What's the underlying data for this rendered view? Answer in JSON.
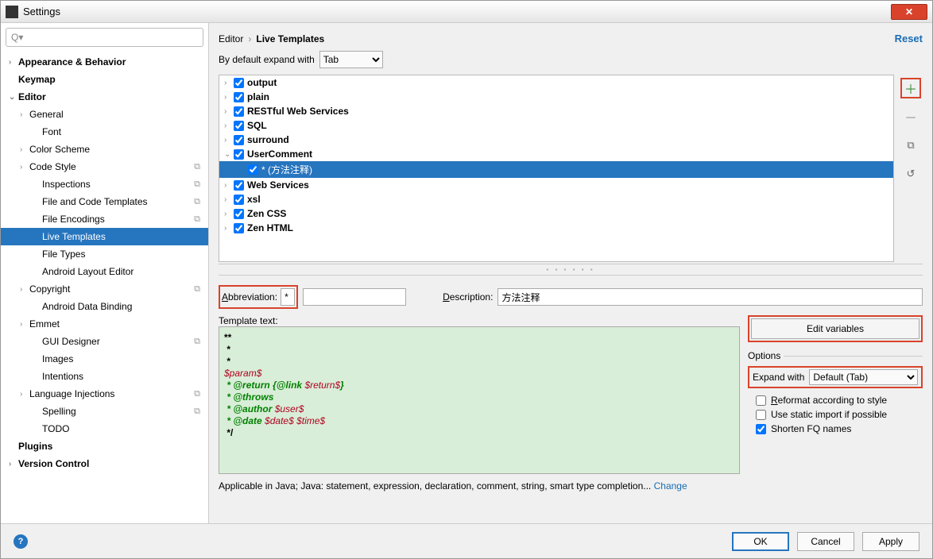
{
  "window": {
    "title": "Settings"
  },
  "breadcrumb": {
    "parent": "Editor",
    "current": "Live Templates",
    "reset": "Reset"
  },
  "search": {
    "placeholder": ""
  },
  "sidebar": {
    "items": [
      {
        "label": "Appearance & Behavior",
        "arrow": "›",
        "bold": true
      },
      {
        "label": "Keymap",
        "arrow": "",
        "bold": true
      },
      {
        "label": "Editor",
        "arrow": "⌄",
        "bold": true
      },
      {
        "label": "General",
        "arrow": "›",
        "indent": 1
      },
      {
        "label": "Font",
        "arrow": "",
        "indent": 2
      },
      {
        "label": "Color Scheme",
        "arrow": "›",
        "indent": 1
      },
      {
        "label": "Code Style",
        "arrow": "›",
        "indent": 1,
        "copyicon": true
      },
      {
        "label": "Inspections",
        "arrow": "",
        "indent": 2,
        "copyicon": true
      },
      {
        "label": "File and Code Templates",
        "arrow": "",
        "indent": 2,
        "copyicon": true
      },
      {
        "label": "File Encodings",
        "arrow": "",
        "indent": 2,
        "copyicon": true
      },
      {
        "label": "Live Templates",
        "arrow": "",
        "indent": 2,
        "selected": true
      },
      {
        "label": "File Types",
        "arrow": "",
        "indent": 2
      },
      {
        "label": "Android Layout Editor",
        "arrow": "",
        "indent": 2
      },
      {
        "label": "Copyright",
        "arrow": "›",
        "indent": 1,
        "copyicon": true
      },
      {
        "label": "Android Data Binding",
        "arrow": "",
        "indent": 2
      },
      {
        "label": "Emmet",
        "arrow": "›",
        "indent": 1
      },
      {
        "label": "GUI Designer",
        "arrow": "",
        "indent": 2,
        "copyicon": true
      },
      {
        "label": "Images",
        "arrow": "",
        "indent": 2
      },
      {
        "label": "Intentions",
        "arrow": "",
        "indent": 2
      },
      {
        "label": "Language Injections",
        "arrow": "›",
        "indent": 1,
        "copyicon": true
      },
      {
        "label": "Spelling",
        "arrow": "",
        "indent": 2,
        "copyicon": true
      },
      {
        "label": "TODO",
        "arrow": "",
        "indent": 2
      },
      {
        "label": "Plugins",
        "arrow": "",
        "bold": true
      },
      {
        "label": "Version Control",
        "arrow": "›",
        "bold": true
      }
    ]
  },
  "expandDefault": {
    "label": "By default expand with",
    "value": "Tab"
  },
  "templates": [
    {
      "label": "output",
      "arrow": "›",
      "checked": true
    },
    {
      "label": "plain",
      "arrow": "›",
      "checked": true
    },
    {
      "label": "RESTful Web Services",
      "arrow": "›",
      "checked": true
    },
    {
      "label": "SQL",
      "arrow": "›",
      "checked": true
    },
    {
      "label": "surround",
      "arrow": "›",
      "checked": true
    },
    {
      "label": "UserComment",
      "arrow": "⌄",
      "checked": true
    },
    {
      "label": "* (方法注释)",
      "arrow": "",
      "checked": true,
      "indent": true,
      "selected": true
    },
    {
      "label": "Web Services",
      "arrow": "›",
      "checked": true
    },
    {
      "label": "xsl",
      "arrow": "›",
      "checked": true
    },
    {
      "label": "Zen CSS",
      "arrow": "›",
      "checked": true
    },
    {
      "label": "Zen HTML",
      "arrow": "›",
      "checked": true
    }
  ],
  "form": {
    "abbrLabel": "Abbreviation:",
    "abbrValue": "*",
    "descLabel": "Description:",
    "descValue": "方法注释",
    "templateTextLabel": "Template text:",
    "editVars": "Edit variables"
  },
  "templateText": {
    "l1": "**",
    "l2": " *",
    "l3": " *",
    "l4": "$param$",
    "l5a": " * @return ",
    "l5b": "{@link ",
    "l5c": "$return$",
    "l5d": "}",
    "l6": " * @throws",
    "l7a": " * @author ",
    "l7b": "$user$",
    "l8a": " * @date ",
    "l8b": "$date$ $time$",
    "l9": " */"
  },
  "options": {
    "title": "Options",
    "expandWithLabel": "Expand with",
    "expandWithValue": "Default (Tab)",
    "reformat": "Reformat according to style",
    "staticImport": "Use static import if possible",
    "shortenFQ": "Shorten FQ names"
  },
  "applicable": {
    "text": "Applicable in Java; Java: statement, expression, declaration, comment, string, smart type completion...",
    "change": "Change"
  },
  "footer": {
    "ok": "OK",
    "cancel": "Cancel",
    "apply": "Apply"
  }
}
